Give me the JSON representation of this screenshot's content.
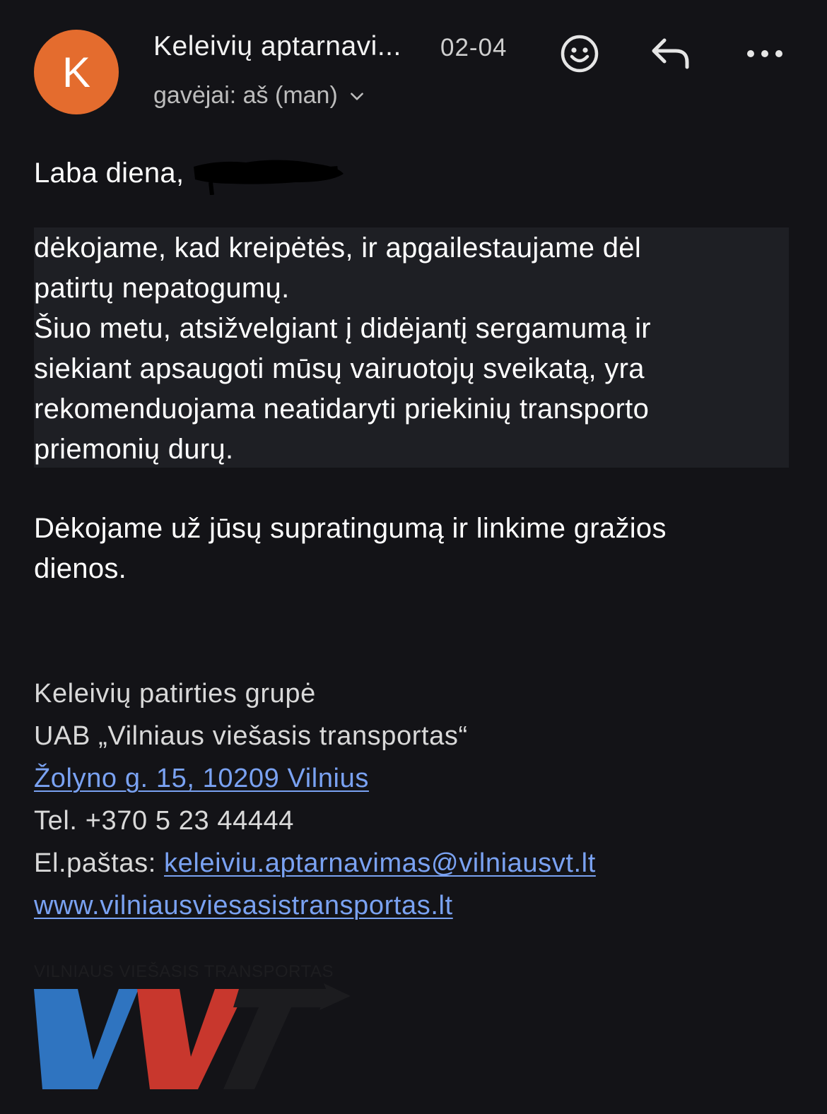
{
  "header": {
    "avatar_letter": "K",
    "sender": "Keleivių aptarnavi...",
    "date": "02-04",
    "recipients": "gavėjai: aš (man)",
    "icons": [
      "avatar",
      "chevron-down-icon",
      "emoji-icon",
      "reply-icon",
      "more-icon"
    ]
  },
  "body": {
    "greeting": "Laba diena,",
    "paragraph1": [
      "dėkojame, kad kreipėtės, ir apgailestaujame dėl",
      "patirtų nepatogumų.",
      "Šiuo metu, atsižvelgiant į didėjantį sergamumą ir",
      "siekiant apsaugoti mūsų vairuotojų sveikatą, yra",
      "rekomenduojama neatidaryti priekinių transporto",
      "priemonių durų."
    ],
    "paragraph2": [
      "Dėkojame už jūsų supratingumą ir linkime gražios",
      "dienos."
    ]
  },
  "signature": {
    "team": "Keleivių patirties grupė",
    "company": "UAB „Vilniaus viešasis transportas“",
    "address": "Žolyno g. 15, 10209 Vilnius",
    "phone": "Tel. +370 5 23 44444",
    "email_label": "El.paštas: ",
    "email": "keleiviu.aptarnavimas@vilniausvt.lt",
    "website": "www.vilniausviesasistransportas.lt"
  },
  "logo": {
    "caption": "VILNIAUS VIEŠASIS TRANSPORTAS",
    "text": "VVT"
  },
  "colors": {
    "background": "#131317",
    "avatar": "#e46c2e",
    "highlight": "#1e1f24",
    "link": "#7aa2f2",
    "logo_blue": "#2f74c0",
    "logo_red": "#c8372d",
    "logo_dark": "#1c1c1f"
  }
}
